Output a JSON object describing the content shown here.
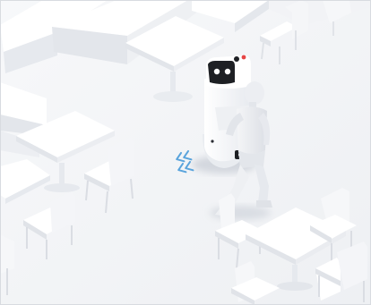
{
  "scene": {
    "subject": "service-robot",
    "companion": "humanoid-figure",
    "setting": "cafe-seating-area",
    "colors": {
      "background": "#f4f5f7",
      "furniture": "#ffffff",
      "furniture_shade": "#e4e7ec",
      "shadow": "#d9dde3",
      "robot_body": "#fafbfc",
      "robot_screen": "#1e2024",
      "robot_eye": "#ffffff",
      "robot_accent": "#e64545",
      "motion_marks": "#5aa4dc"
    },
    "icons": {
      "motion_indicator": "chevron-waves-icon"
    }
  }
}
